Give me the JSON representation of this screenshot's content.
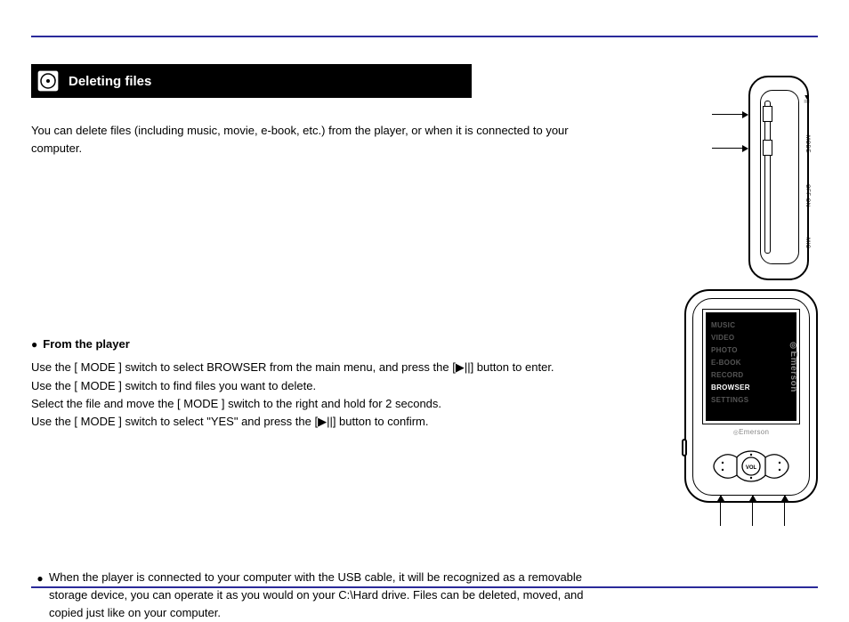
{
  "heading": {
    "title": "Deleting files"
  },
  "sections": {
    "intro": "You can delete files (including music, movie, e-book, etc.) from the player, or when it is connected to your computer.",
    "fromPlayer": {
      "title": "From the player",
      "steps": "Use the [ MODE ] switch to select BROWSER from the main menu, and press the [▶||] button to enter.\nUse the [ MODE ] switch to find files you want to delete.\nSelect the file and move the [ MODE ] switch to the right and hold for 2 seconds.\nUse the [ MODE ] switch to select \"YES\" and press the [▶||] button to confirm."
    },
    "fromComputer": {
      "text": "When the player is connected to your computer with the USB cable, it will be recognized as a removable storage device, you can operate it as you would on your C:\\Hard drive. Files can be deleted, moved, and copied just like on your computer."
    }
  },
  "device": {
    "sideLabels": {
      "playPause": "▶||",
      "mode": "MODE",
      "off": "OFF ON",
      "mic": "MIC"
    },
    "menu": {
      "items": [
        "MUSIC",
        "VIDEO",
        "PHOTO",
        "E-BOOK",
        "RECORD",
        "BROWSER",
        "SETTINGS"
      ],
      "activeIndex": 5
    },
    "brand": "Emerson",
    "bottomLabel": "Emerson",
    "volLabel": "VOL"
  }
}
